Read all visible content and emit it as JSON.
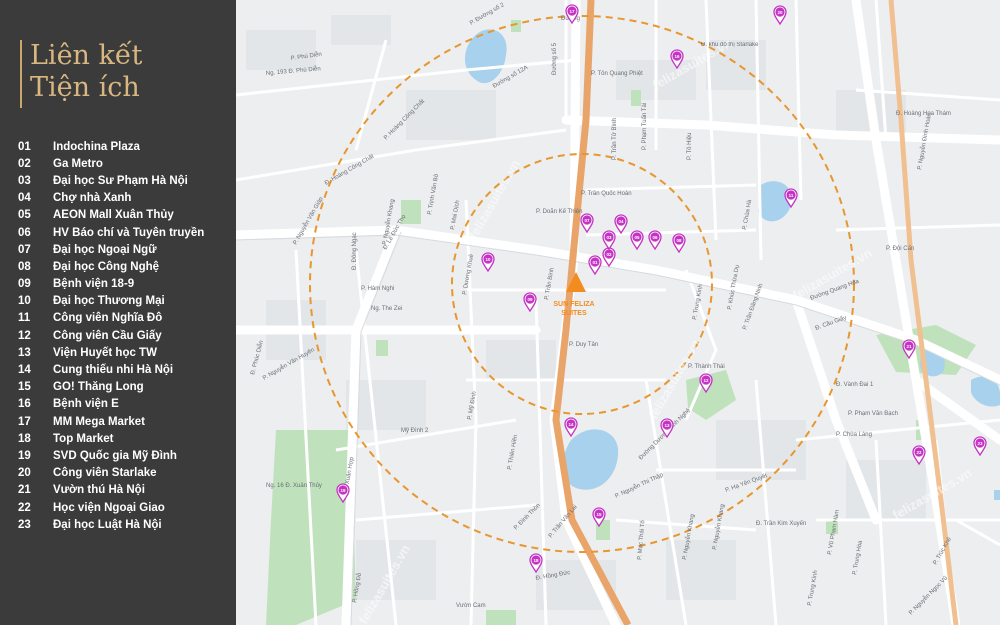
{
  "sidebar": {
    "title_line1": "Liên kết",
    "title_line2": "Tiện ích",
    "items": [
      {
        "num": "01",
        "name": "Indochina Plaza"
      },
      {
        "num": "02",
        "name": "Ga Metro"
      },
      {
        "num": "03",
        "name": "Đại học Sư Phạm Hà Nội"
      },
      {
        "num": "04",
        "name": "Chợ nhà Xanh"
      },
      {
        "num": "05",
        "name": "AEON Mall Xuân Thủy"
      },
      {
        "num": "06",
        "name": "HV Báo chí và Tuyên truyền"
      },
      {
        "num": "07",
        "name": "Đại học Ngoại Ngữ"
      },
      {
        "num": "08",
        "name": "Đại học Công Nghệ"
      },
      {
        "num": "09",
        "name": "Bệnh viện 18-9"
      },
      {
        "num": "10",
        "name": "Đại học Thương Mại"
      },
      {
        "num": "11",
        "name": "Công viên Nghĩa Đô"
      },
      {
        "num": "12",
        "name": "Công viên Cầu Giấy"
      },
      {
        "num": "13",
        "name": "Viện Huyết học TW"
      },
      {
        "num": "14",
        "name": "Cung thiếu nhi Hà Nội"
      },
      {
        "num": "15",
        "name": "GO! Thăng Long"
      },
      {
        "num": "16",
        "name": "Bệnh viện E"
      },
      {
        "num": "17",
        "name": "MM Mega Market"
      },
      {
        "num": "18",
        "name": "Top Market"
      },
      {
        "num": "19",
        "name": "SVD Quốc gia Mỹ Đình"
      },
      {
        "num": "20",
        "name": "Công viên Starlake"
      },
      {
        "num": "21",
        "name": "Vườn thú Hà Nội"
      },
      {
        "num": "22",
        "name": "Học viện Ngoại Giao"
      },
      {
        "num": "23",
        "name": "Đại học Luật Hà Nội"
      }
    ]
  },
  "map": {
    "center_label_1": "SUN FELIZA",
    "center_label_2": "SUITES",
    "watermark": "felizasuites.vn",
    "colors": {
      "accent": "#f28c1f",
      "pin": "#c433c4",
      "ring": "#e8962e",
      "road": "#ffffff",
      "water": "#a9d3ee",
      "park": "#b9dfb6"
    },
    "pins": [
      "01",
      "02",
      "03",
      "04",
      "05",
      "06",
      "07",
      "08",
      "09",
      "10",
      "11",
      "12",
      "13",
      "14",
      "15",
      "16",
      "17",
      "18",
      "19",
      "20",
      "21",
      "22",
      "23"
    ],
    "street_labels": [
      "Đường",
      "P. Phú Diễn",
      "Ng. 193 Đ. Phú Diễn",
      "Đường số 12A",
      "P. Đường số 2",
      "Đường số 5",
      "P. Tôn Quang Phiệt",
      "Đ. khu đô thị Starlake",
      "P. Hoàng Công Chất",
      "Đ. Hoàng Công Chất",
      "P. Trần Quốc Hoàn",
      "P. Doãn Kế Thiện",
      "P. Phạm Tuấn Tài",
      "P. Trần Tử Bình",
      "P. Tô Hiệu",
      "Đ. Hoàng Hoa Thám",
      "P. Đội Cấn",
      "P. Nguyễn Đình Hoàn",
      "P. Chùa Hà",
      "Đường Quang Hòa",
      "P. Nguyễn Văn Giáp",
      "Đ. Đông Ngạc",
      "P. Trịnh Văn Bô",
      "P. Mai Dịch",
      "P. Nguyễn Khang",
      "Đ. Lê Đức Thọ",
      "P. Hàm Nghi",
      "Ng. The Zei",
      "P. Dương Khuê",
      "P. Trần Bình",
      "P. Duy Tân",
      "P. Trung Kính",
      "P. Nguyễn Văn Huyên",
      "P. Khúc Thừa Dụ",
      "P. Trần Đăng Ninh",
      "P. Thành Thái",
      "Đ. Cầu Giấy",
      "Đ. Phúc Diễn",
      "Mỹ Đình 2",
      "P. Mỹ Đình",
      "Ng. 16 Đ. Xuân Thủy",
      "P. Đồ Xuân Hợp",
      "P. Thiên Hiền",
      "P. Đình Thôn",
      "P. Trần Văn Lai",
      "Đ. Hồng Đức",
      "Đường Dương Đình Nghệ",
      "P. Nguyễn Thị Thập",
      "P. Hạ Yên Quyết",
      "P. Mạc Thái Tổ",
      "P. Nguyễn Khang",
      "Đ. Trần Kim Xuyến",
      "P. Nguyễn Khang",
      "P. Vũ Phạm Hàm",
      "P. Trung Hòa",
      "P. Trung Kính",
      "P. Nguyễn Ngọc Vũ",
      "P. Chùa Láng",
      "Đ. Vành Đai 1",
      "P. Phạm Văn Bạch",
      "Vườn Cam",
      "P. Hồng Đỗ",
      "P. Trúc Khê"
    ]
  }
}
